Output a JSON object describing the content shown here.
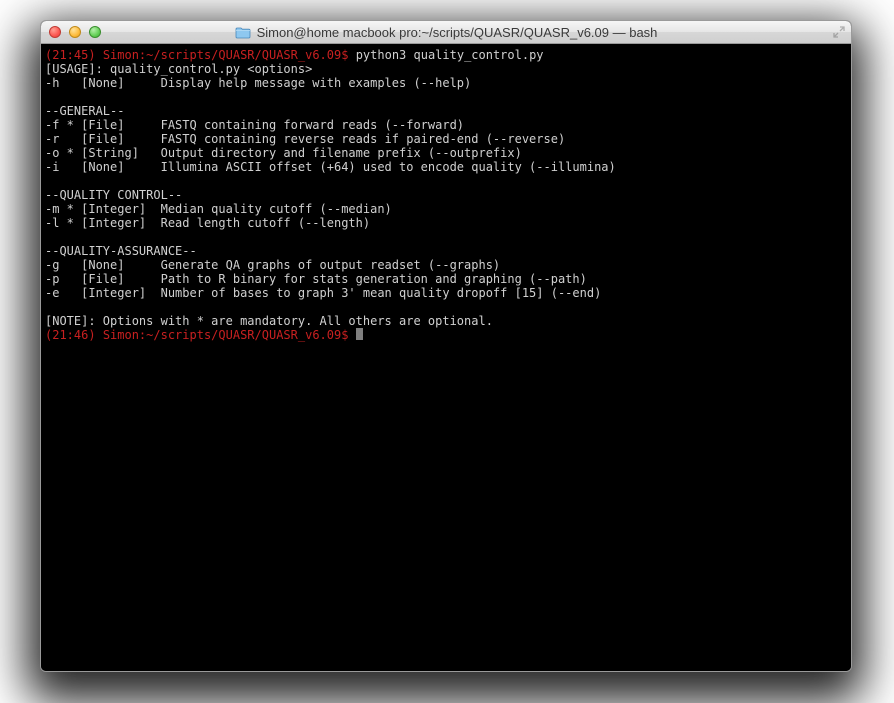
{
  "window": {
    "title": "Simon@home macbook pro:~/scripts/QUASR/QUASR_v6.09 — bash"
  },
  "prompt1": {
    "time": "(21:45)",
    "userpath": "Simon:~/scripts/QUASR/QUASR_v6.09",
    "dollar": "$",
    "command": " python3 quality_control.py"
  },
  "usage": {
    "line": "[USAGE]: quality_control.py <options>",
    "help": "-h   [None]     Display help message with examples (--help)"
  },
  "general": {
    "header": "--GENERAL--",
    "f": "-f * [File]     FASTQ containing forward reads (--forward)",
    "r": "-r   [File]     FASTQ containing reverse reads if paired-end (--reverse)",
    "o": "-o * [String]   Output directory and filename prefix (--outprefix)",
    "i": "-i   [None]     Illumina ASCII offset (+64) used to encode quality (--illumina)"
  },
  "qc": {
    "header": "--QUALITY CONTROL--",
    "m": "-m * [Integer]  Median quality cutoff (--median)",
    "l": "-l * [Integer]  Read length cutoff (--length)"
  },
  "qa": {
    "header": "--QUALITY-ASSURANCE--",
    "g": "-g   [None]     Generate QA graphs of output readset (--graphs)",
    "p": "-p   [File]     Path to R binary for stats generation and graphing (--path)",
    "e": "-e   [Integer]  Number of bases to graph 3' mean quality dropoff [15] (--end)"
  },
  "note": "[NOTE]: Options with * are mandatory. All others are optional.",
  "prompt2": {
    "time": "(21:46)",
    "userpath": "Simon:~/scripts/QUASR/QUASR_v6.09",
    "dollar": "$"
  }
}
